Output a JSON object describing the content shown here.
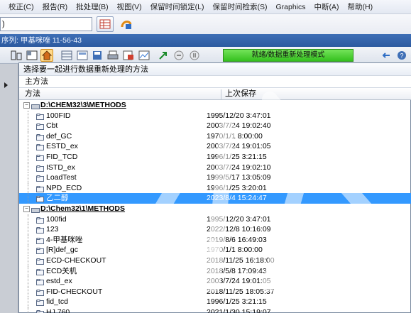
{
  "menu": [
    "校正(C)",
    "报告(R)",
    "批处理(B)",
    "视图(V)",
    "保留时间锁定(L)",
    "保留时间检索(S)",
    "Graphics",
    "中断(A)",
    "帮助(H)"
  ],
  "combo": {
    "value": ")"
  },
  "sequence_label": "序列: 甲基咪唑 11-56-43",
  "status_text": "就绪/数据重新处理模式",
  "dialog": {
    "title": "选择要一起进行数据重新处理的方法",
    "section": "主方法",
    "col_method": "方法",
    "col_saved": "上次保存"
  },
  "groups": [
    {
      "path": "D:\\CHEM32\\3\\METHODS",
      "items": [
        {
          "name": "100FID",
          "date": "1995/12/20 3:47:01"
        },
        {
          "name": "Cbt",
          "date": "2003/7/24 19:02:40"
        },
        {
          "name": "def_GC",
          "date": "1970/1/1 8:00:00"
        },
        {
          "name": "ESTD_ex",
          "date": "2003/7/24 19:01:05"
        },
        {
          "name": "FID_TCD",
          "date": "1996/1/25 3:21:15"
        },
        {
          "name": "ISTD_ex",
          "date": "2003/7/24 19:02:10"
        },
        {
          "name": "LoadTest",
          "date": "1999/5/17 13:05:09"
        },
        {
          "name": "NPD_ECD",
          "date": "1996/1/25 3:20:01"
        },
        {
          "name": "乙二醇",
          "date": "2023/8/4 15:24:47",
          "selected": true
        }
      ]
    },
    {
      "path": "D:\\Chem32\\1\\METHODS",
      "items": [
        {
          "name": "100fid",
          "date": "1995/12/20 3:47:01"
        },
        {
          "name": "123",
          "date": "2022/12/8 10:16:09"
        },
        {
          "name": "4-甲基咪唑",
          "date": "2019/8/6 16:49:03"
        },
        {
          "name": "[R]def_gc",
          "date": "1970/1/1 8:00:00"
        },
        {
          "name": "ECD-CHECKOUT",
          "date": "2018/11/25 16:18:00"
        },
        {
          "name": "ECD关机",
          "date": "2018/5/8 17:09:43"
        },
        {
          "name": "estd_ex",
          "date": "2003/7/24 19:01:05"
        },
        {
          "name": "FID-CHECKOUT",
          "date": "2018/11/25 18:05:37"
        },
        {
          "name": "fid_tcd",
          "date": "1996/1/25 3:21:15"
        },
        {
          "name": "HJ 760",
          "date": "2021/1/30 15:19:07"
        }
      ]
    }
  ],
  "colors": {
    "selection": "#3399ff",
    "status_green": "#34c01e",
    "seq_bar": "#2c5aa0"
  }
}
